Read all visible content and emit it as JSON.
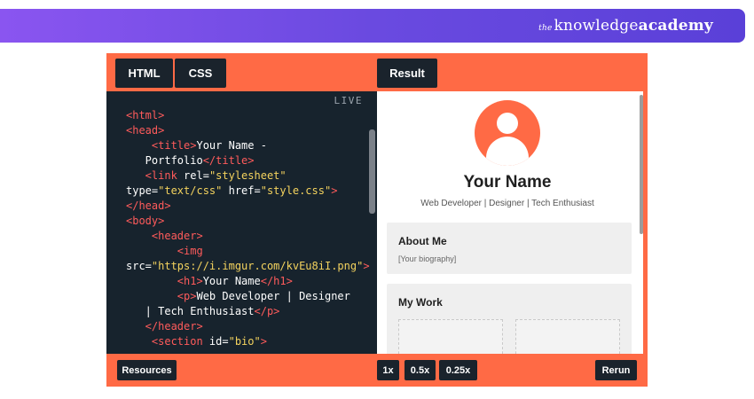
{
  "brand": {
    "the": "the",
    "knowledge": "knowledge",
    "academy": "academy"
  },
  "toolbar": {
    "html_tab": "HTML",
    "css_tab": "CSS",
    "result_tab": "Result"
  },
  "editor": {
    "live_label": "LIVE",
    "lines": [
      [
        {
          "c": "t",
          "v": "<html>"
        }
      ],
      [
        {
          "c": "t",
          "v": "<head>"
        }
      ],
      [
        {
          "c": "t",
          "v": "    <title>"
        },
        {
          "c": "a",
          "v": "Your Name -"
        }
      ],
      [
        {
          "c": "a",
          "v": "   Portfolio"
        },
        {
          "c": "t",
          "v": "</title>"
        }
      ],
      [
        {
          "c": "t",
          "v": "   <link "
        },
        {
          "c": "a",
          "v": "rel="
        },
        {
          "c": "s",
          "v": "\"stylesheet\""
        }
      ],
      [
        {
          "c": "a",
          "v": "type="
        },
        {
          "c": "s",
          "v": "\"text/css\""
        },
        {
          "c": "a",
          "v": " href="
        },
        {
          "c": "s",
          "v": "\"style.css\""
        },
        {
          "c": "t",
          "v": ">"
        }
      ],
      [
        {
          "c": "t",
          "v": "</head>"
        }
      ],
      [
        {
          "c": "t",
          "v": "<body>"
        }
      ],
      [
        {
          "c": "t",
          "v": "    <header>"
        }
      ],
      [
        {
          "c": "t",
          "v": "        <img"
        }
      ],
      [
        {
          "c": "a",
          "v": "src="
        },
        {
          "c": "s",
          "v": "\"https://i.imgur.com/kvEu8iI.png\""
        },
        {
          "c": "t",
          "v": ">"
        }
      ],
      [
        {
          "c": "t",
          "v": "        <h1>"
        },
        {
          "c": "a",
          "v": "Your Name"
        },
        {
          "c": "t",
          "v": "</h1>"
        }
      ],
      [
        {
          "c": "t",
          "v": "        <p>"
        },
        {
          "c": "a",
          "v": "Web Developer | Designer"
        }
      ],
      [
        {
          "c": "a",
          "v": "   | Tech Enthusiast"
        },
        {
          "c": "t",
          "v": "</p>"
        }
      ],
      [
        {
          "c": "t",
          "v": "   </header>"
        }
      ],
      [
        {
          "c": "t",
          "v": "    <section "
        },
        {
          "c": "a",
          "v": "id="
        },
        {
          "c": "s",
          "v": "\"bio\""
        },
        {
          "c": "t",
          "v": ">"
        }
      ]
    ]
  },
  "result": {
    "name": "Your Name",
    "subtitle": "Web Developer | Designer | Tech Enthusiast",
    "about_title": "About Me",
    "about_text": "[Your biography]",
    "work_title": "My Work"
  },
  "bottom": {
    "resources": "Resources",
    "speed_1x": "1x",
    "speed_05x": "0.5x",
    "speed_025x": "0.25x",
    "rerun": "Rerun"
  },
  "colors": {
    "accent": "#ff6a45",
    "code_bg": "#17232d",
    "tag": "#ff5b5b",
    "string": "#f4d35e",
    "banner_start": "#8a55f0",
    "banner_end": "#5a40d8"
  }
}
